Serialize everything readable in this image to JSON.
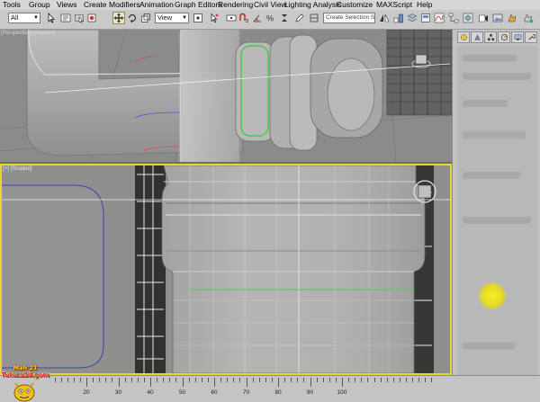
{
  "menu": [
    "Tools",
    "Group",
    "Views",
    "Create",
    "Modifiers",
    "Animation",
    "Graph Editors",
    "Rendering",
    "Civil View",
    "Lighting Analysis",
    "Customize",
    "MAXScript",
    "Help"
  ],
  "toolbar": {
    "filter_value": "All",
    "ref_coord_value": "View",
    "named_selection_placeholder": "Create Selection Se"
  },
  "viewports": {
    "top_label": "[Perspective] [Shaded]",
    "front_label": "[+] [Shaded]"
  },
  "timeline": {
    "labels": [
      "20",
      "30",
      "40",
      "50",
      "60",
      "70",
      "80",
      "90",
      "100"
    ]
  },
  "logo": {
    "line1": "Mah 21 Training",
    "line2": "Tutors3d.com"
  },
  "icons": {
    "toolbar": [
      "select-object-icon",
      "select-by-name-icon",
      "rect-region-icon",
      "window-crossing-icon",
      "move-icon",
      "rotate-icon",
      "scale-icon",
      "use-pivot-icon",
      "manipulate-icon",
      "keyboard-shortcut-icon",
      "snap-3-icon",
      "angle-snap-icon",
      "percent-snap-icon",
      "spinner-snap-icon",
      "edit-named-sel-icon",
      "mirror-icon",
      "align-icon",
      "layer-manager-icon",
      "graphite-icon",
      "curve-editor-icon",
      "schematic-icon",
      "material-editor-icon",
      "render-setup-icon",
      "rendered-frame-icon",
      "render-icon"
    ],
    "panel_tabs": [
      "create-tab-icon",
      "modify-tab-icon",
      "hierarchy-tab-icon",
      "motion-tab-icon",
      "display-tab-icon",
      "utilities-tab-icon"
    ]
  },
  "colors": {
    "active_viewport_border": "#e3d832",
    "selection_highlight": "#4bd64b"
  }
}
